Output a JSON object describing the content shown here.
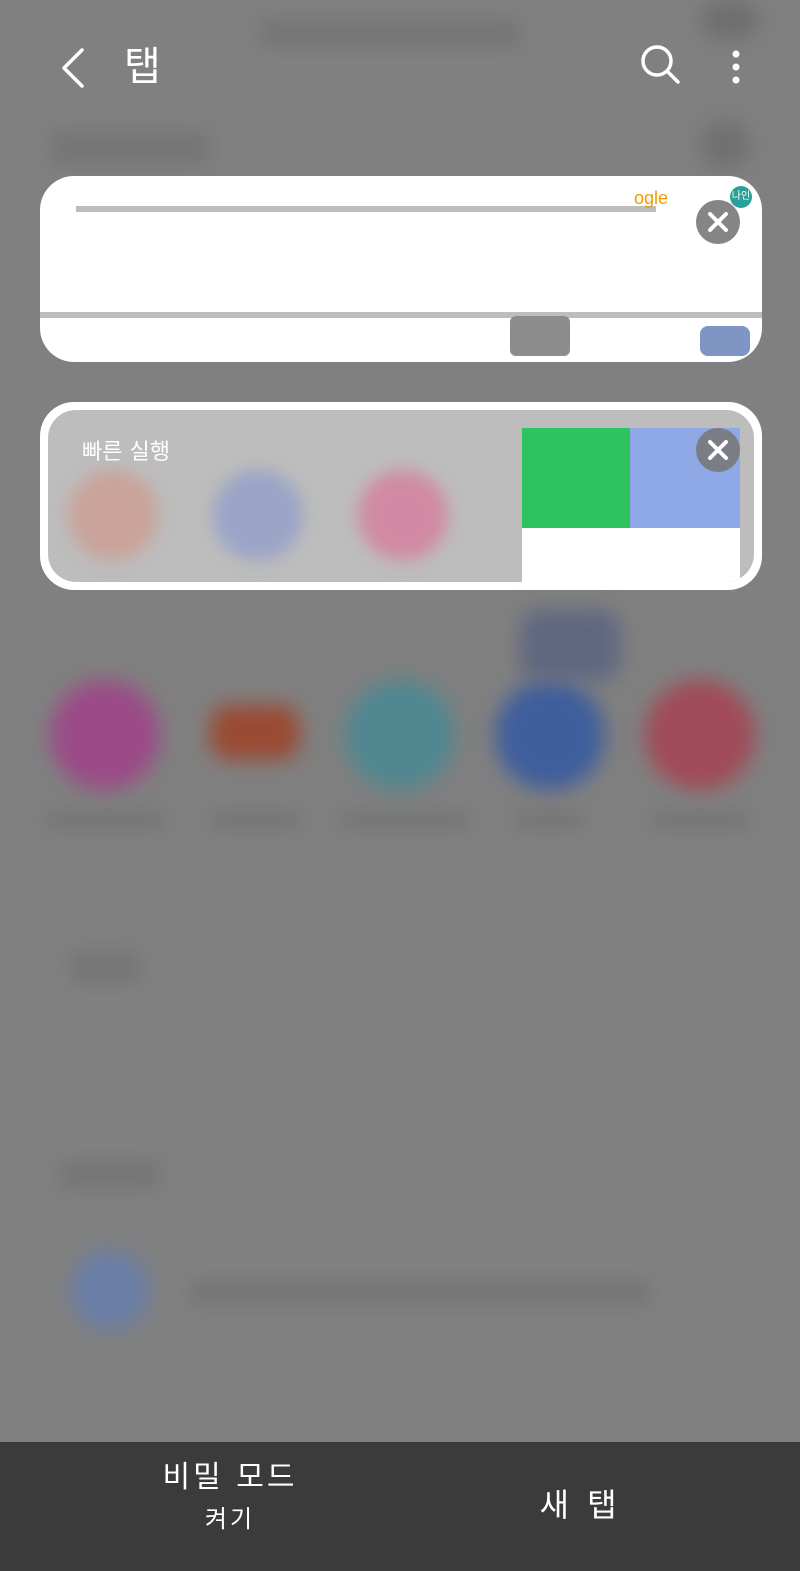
{
  "header": {
    "title": "탭",
    "back_icon": "back-arrow-icon",
    "search_icon": "search-icon",
    "more_icon": "more-vertical-icon"
  },
  "tabs": [
    {
      "google_text": "ogle",
      "badge": "나인"
    },
    {
      "label": "빠른 실행"
    }
  ],
  "bottom_bar": {
    "secret_mode_line1": "비밀 모드",
    "secret_mode_line2": "켜기",
    "new_tab": "새 탭"
  },
  "colors": {
    "background_dim": "#808080",
    "toolbar": "#3b3b3b",
    "accent_green": "#2dc35f",
    "accent_blue": "#8fa8e6"
  }
}
